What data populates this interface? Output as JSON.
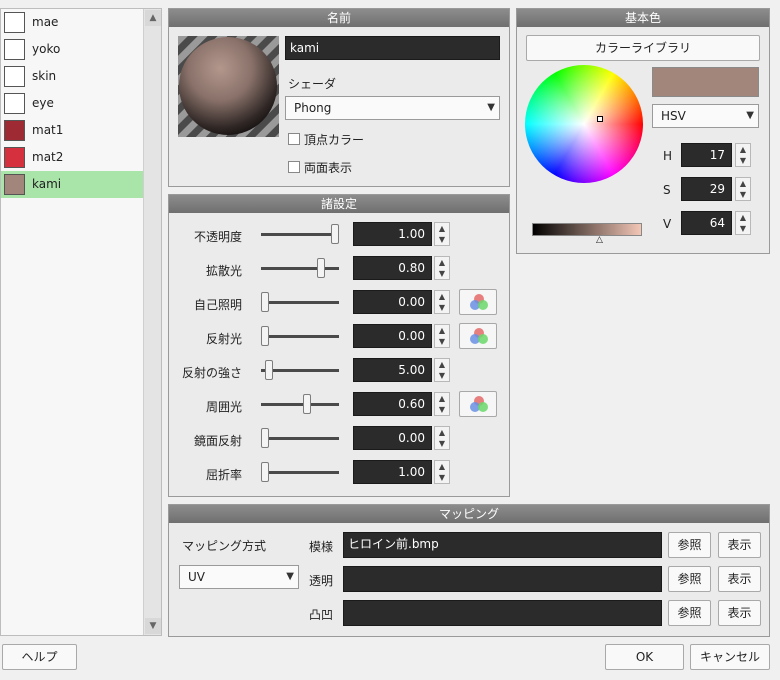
{
  "materials": [
    {
      "name": "mae",
      "color": "#ffffff"
    },
    {
      "name": "yoko",
      "color": "#ffffff"
    },
    {
      "name": "skin",
      "color": "#ffffff"
    },
    {
      "name": "eye",
      "color": "#ffffff"
    },
    {
      "name": "mat1",
      "color": "#9e2a33"
    },
    {
      "name": "mat2",
      "color": "#d5303d"
    },
    {
      "name": "kami",
      "color": "#a2867c",
      "selected": true
    }
  ],
  "name_panel": {
    "title": "名前",
    "name_value": "kami",
    "shader_label": "シェーダ",
    "shader_value": "Phong",
    "vertex_color_label": "頂点カラー",
    "double_sided_label": "両面表示"
  },
  "base_color": {
    "title": "基本色",
    "library_button": "カラーライブラリ",
    "swatch_color": "#a2867c",
    "mode_value": "HSV",
    "h_label": "H",
    "h_value": "17",
    "s_label": "S",
    "s_value": "29",
    "v_label": "V",
    "v_value": "64"
  },
  "settings": {
    "title": "諸設定",
    "rows": [
      {
        "label": "不透明度",
        "value": "1.00",
        "level": 1.0,
        "mix": false
      },
      {
        "label": "拡散光",
        "value": "0.80",
        "level": 0.8,
        "mix": false
      },
      {
        "label": "自己照明",
        "value": "0.00",
        "level": 0.0,
        "mix": true
      },
      {
        "label": "反射光",
        "value": "0.00",
        "level": 0.0,
        "mix": true
      },
      {
        "label": "反射の強さ",
        "value": "5.00",
        "level": 0.05,
        "mix": false
      },
      {
        "label": "周囲光",
        "value": "0.60",
        "level": 0.6,
        "mix": true
      },
      {
        "label": "鏡面反射",
        "value": "0.00",
        "level": 0.0,
        "mix": false
      },
      {
        "label": "屈折率",
        "value": "1.00",
        "level": 0.0,
        "mix": false
      }
    ]
  },
  "mapping": {
    "title": "マッピング",
    "method_label": "マッピング方式",
    "method_value": "UV",
    "rows": [
      {
        "label": "模様",
        "value": "ヒロイン前.bmp",
        "browse": "参照",
        "show": "表示"
      },
      {
        "label": "透明",
        "value": "",
        "browse": "参照",
        "show": "表示"
      },
      {
        "label": "凸凹",
        "value": "",
        "browse": "参照",
        "show": "表示"
      }
    ]
  },
  "footer": {
    "help": "ヘルプ",
    "ok": "OK",
    "cancel": "キャンセル"
  }
}
